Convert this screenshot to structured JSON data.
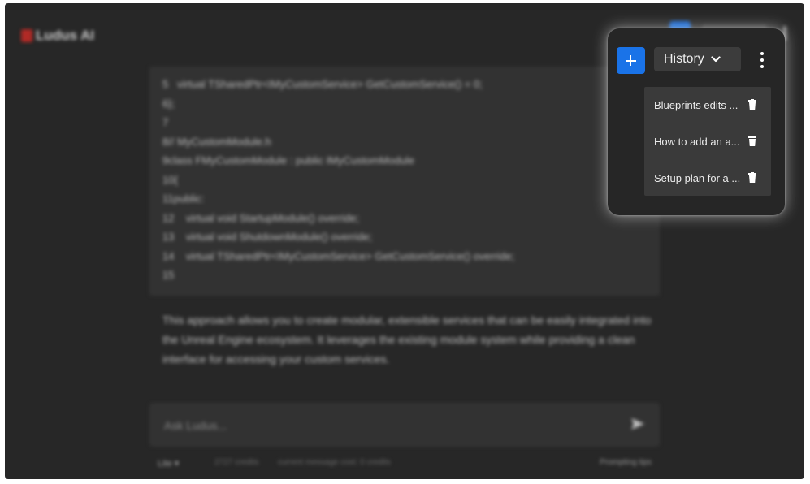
{
  "app": {
    "name": "Ludus AI"
  },
  "code": {
    "lines": [
      "5   virtual TSharedPtr<IMyCustomService> GetCustomService() = 0;",
      "6};",
      "7",
      "8// MyCustomModule.h",
      "9class FMyCustomModule : public IMyCustomModule",
      "10{",
      "11public:",
      "12    virtual void StartupModule() override;",
      "13    virtual void ShutdownModule() override;",
      "14    virtual TSharedPtr<IMyCustomService> GetCustomService() override;",
      "15"
    ]
  },
  "answer": {
    "text": "This approach allows you to create modular, extensible services that can be easily integrated into the Unreal Engine ecosystem. It leverages the existing module system while providing a clean interface for accessing your custom services."
  },
  "prompt": {
    "placeholder": "Ask Ludus..."
  },
  "footer": {
    "model": "Lite",
    "credits": "2727 credits",
    "message_cost": "current message cost: 0 credits",
    "tips": "Prompting tips"
  },
  "history_panel": {
    "dropdown_label": "History",
    "items": [
      {
        "label": "Blueprints edits ..."
      },
      {
        "label": "How to add an a..."
      },
      {
        "label": "Setup plan for a ..."
      }
    ]
  },
  "icons": {
    "new_chat": "plus-icon",
    "dropdown": "chevron-down-icon",
    "menu": "kebab-icon",
    "delete": "trash-icon",
    "send": "send-icon"
  },
  "colors": {
    "accent": "#1a73e8",
    "background": "#2d2d2d",
    "panel": "#262626",
    "list_bg": "#3a3a3a",
    "logo": "#c9302c"
  }
}
